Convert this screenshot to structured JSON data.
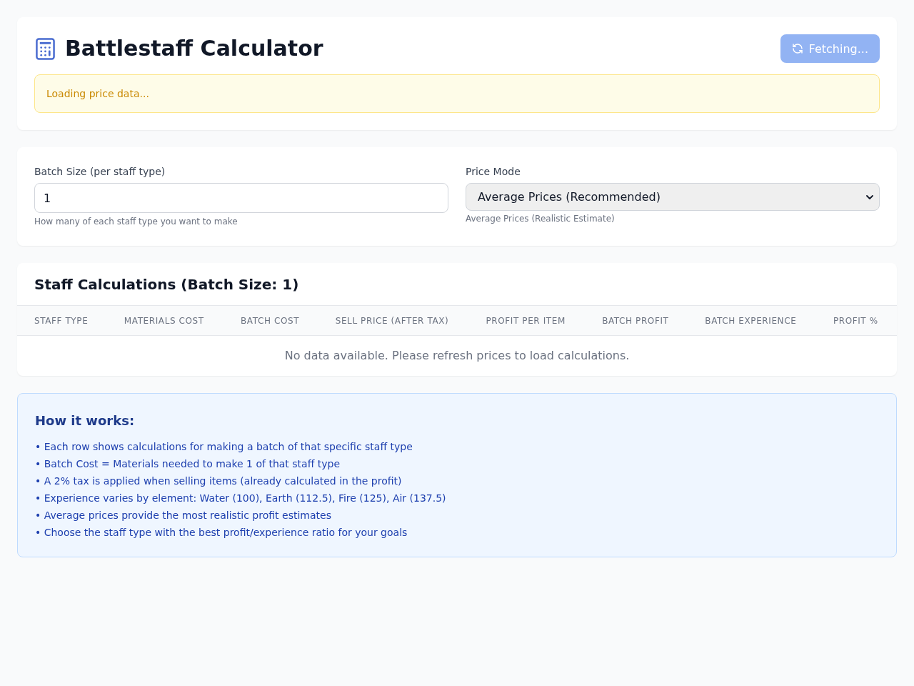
{
  "header": {
    "title": "Battlestaff Calculator",
    "refresh_button": {
      "label": "Fetching...",
      "disabled": true
    },
    "alert": "Loading price data..."
  },
  "settings": {
    "batch_size": {
      "label": "Batch Size (per staff type)",
      "value": "1",
      "hint": "How many of each staff type you want to make"
    },
    "price_mode": {
      "label": "Price Mode",
      "value": "Average Prices (Recommended)",
      "hint": "Average Prices (Realistic Estimate)"
    }
  },
  "table": {
    "title": "Staff Calculations (Batch Size: 1)",
    "columns": [
      "STAFF TYPE",
      "MATERIALS COST",
      "BATCH COST",
      "SELL PRICE (AFTER TAX)",
      "PROFIT PER ITEM",
      "BATCH PROFIT",
      "BATCH EXPERIENCE",
      "PROFIT %"
    ],
    "empty_message": "No data available. Please refresh prices to load calculations."
  },
  "info": {
    "title": "How it works:",
    "items": [
      "• Each row shows calculations for making a batch of that specific staff type",
      "• Batch Cost = Materials needed to make 1 of that staff type",
      "• A 2% tax is applied when selling items (already calculated in the profit)",
      "• Experience varies by element: Water (100), Earth (112.5), Fire (125), Air (137.5)",
      "• Average prices provide the most realistic profit estimates",
      "• Choose the staff type with the best profit/experience ratio for your goals"
    ]
  }
}
